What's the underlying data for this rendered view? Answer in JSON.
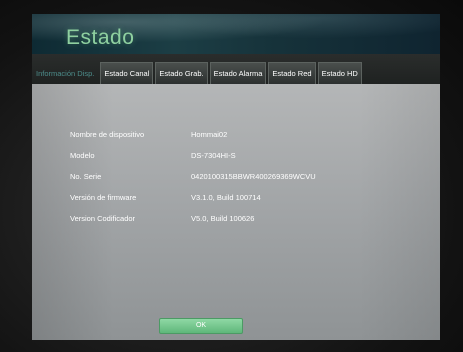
{
  "header": {
    "title": "Estado"
  },
  "tabs": [
    {
      "label": "Información Disp."
    },
    {
      "label": "Estado Canal"
    },
    {
      "label": "Estado Grab."
    },
    {
      "label": "Estado Alarma"
    },
    {
      "label": "Estado Red"
    },
    {
      "label": "Estado HD"
    }
  ],
  "device_info": [
    {
      "label": "Nombre de dispositivo",
      "value": "Hommai02"
    },
    {
      "label": "Modelo",
      "value": "DS-7304HI-S"
    },
    {
      "label": "No. Serie",
      "value": "0420100315BBWR400269369WCVU"
    },
    {
      "label": "Versión de firmware",
      "value": "V3.1.0, Build 100714"
    },
    {
      "label": "Version Codificador",
      "value": "V5.0, Build 100626"
    }
  ],
  "footer": {
    "ok_label": "OK"
  },
  "colors": {
    "title": "#8fd0a0",
    "active_tab": "#4c8c8a",
    "ok_button": "#6cc489"
  }
}
